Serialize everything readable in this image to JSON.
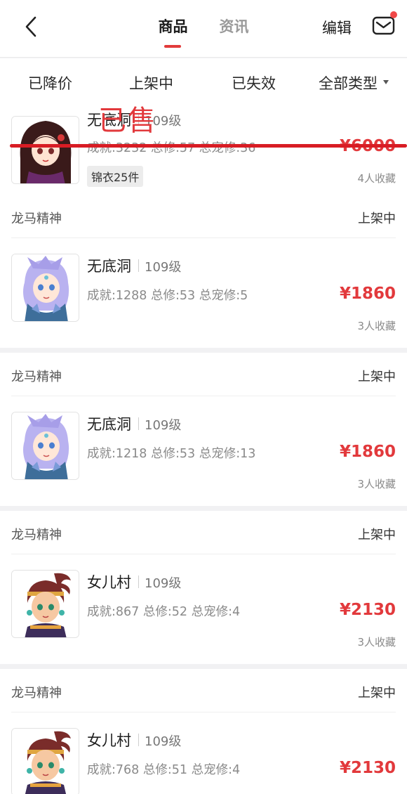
{
  "nav": {
    "tabs": [
      {
        "label": "商品",
        "active": true
      },
      {
        "label": "资讯",
        "active": false
      }
    ],
    "edit_label": "编辑",
    "back_icon": "chevron-left-icon",
    "mail_icon": "mail-icon",
    "accent_color": "#e23b3b"
  },
  "filters": [
    {
      "label": "已降价"
    },
    {
      "label": "上架中"
    },
    {
      "label": "已失效"
    },
    {
      "label": "全部类型",
      "dropdown": true
    }
  ],
  "sold_card": {
    "role": "无底洞",
    "level": "109级",
    "stats": "成就:3232 总修:57 总宠修:36",
    "price": "¥6000",
    "favorites": "4人收藏",
    "tag": "锦衣25件",
    "stamp": "已售"
  },
  "listings": [
    {
      "seller": "龙马精神",
      "status": "上架中",
      "role": "无底洞",
      "level": "109级",
      "stats": "成就:1288 总修:53 总宠修:5",
      "price": "¥1860",
      "favorites": "3人收藏",
      "avatar": "purple-hair-character"
    },
    {
      "seller": "龙马精神",
      "status": "上架中",
      "role": "无底洞",
      "level": "109级",
      "stats": "成就:1218 总修:53 总宠修:13",
      "price": "¥1860",
      "favorites": "3人收藏",
      "avatar": "purple-hair-character"
    },
    {
      "seller": "龙马精神",
      "status": "上架中",
      "role": "女儿村",
      "level": "109级",
      "stats": "成就:867 总修:52 总宠修:4",
      "price": "¥2130",
      "favorites": "3人收藏",
      "avatar": "tribal-girl-character"
    },
    {
      "seller": "龙马精神",
      "status": "上架中",
      "role": "女儿村",
      "level": "109级",
      "stats": "成就:768 总修:51 总宠修:4",
      "price": "¥2130",
      "favorites": "",
      "avatar": "tribal-girl-character"
    }
  ]
}
